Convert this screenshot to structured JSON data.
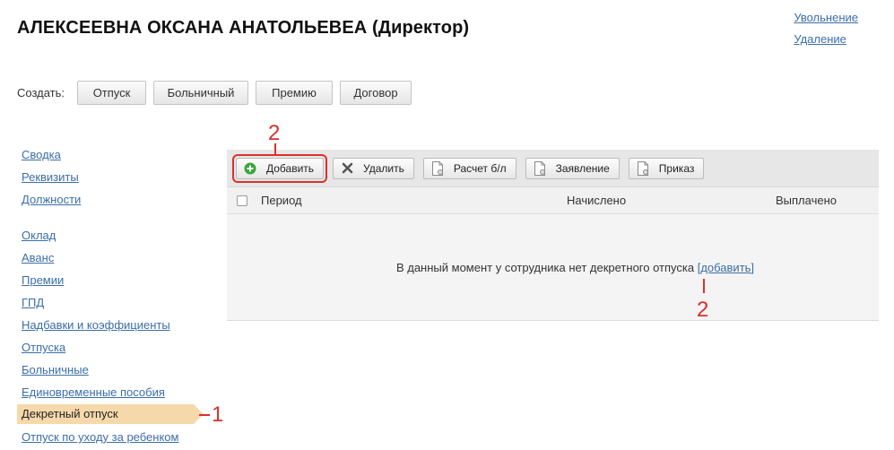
{
  "header": {
    "title": "АЛЕКСЕЕВНА ОКСАНА АНАТОЛЬЕВЕА (Директор)",
    "links": {
      "dismiss": "Увольнение",
      "delete": "Удаление"
    }
  },
  "create": {
    "label": "Создать:",
    "buttons": [
      "Отпуск",
      "Больничный",
      "Премию",
      "Договор"
    ]
  },
  "sidebar": {
    "group1": [
      "Сводка",
      "Реквизиты",
      "Должности"
    ],
    "group2": [
      "Оклад",
      "Аванс",
      "Премии",
      "ГПД",
      "Надбавки и коэффициенты",
      "Отпуска",
      "Больничные",
      "Единовременные пособия"
    ],
    "active": "Декретный отпуск",
    "after": [
      "Отпуск по уходу за ребенком"
    ]
  },
  "toolbar": {
    "add": "Добавить",
    "delete": "Удалить",
    "calc": "Расчет б/л",
    "application": "Заявление",
    "order": "Приказ"
  },
  "table": {
    "columns": {
      "period": "Период",
      "accrued": "Начислено",
      "paid": "Выплачено"
    },
    "empty_text": "В данный момент у сотрудника нет декретного отпуска",
    "empty_link": "[добавить]"
  },
  "annotations": {
    "n1": "1",
    "n2_top": "2",
    "n2_bottom": "2"
  },
  "colors": {
    "link": "#3b6ea8",
    "annotation": "#d9302c",
    "active_item": "#f6d9ab",
    "add_icon": "#3aa53a"
  }
}
